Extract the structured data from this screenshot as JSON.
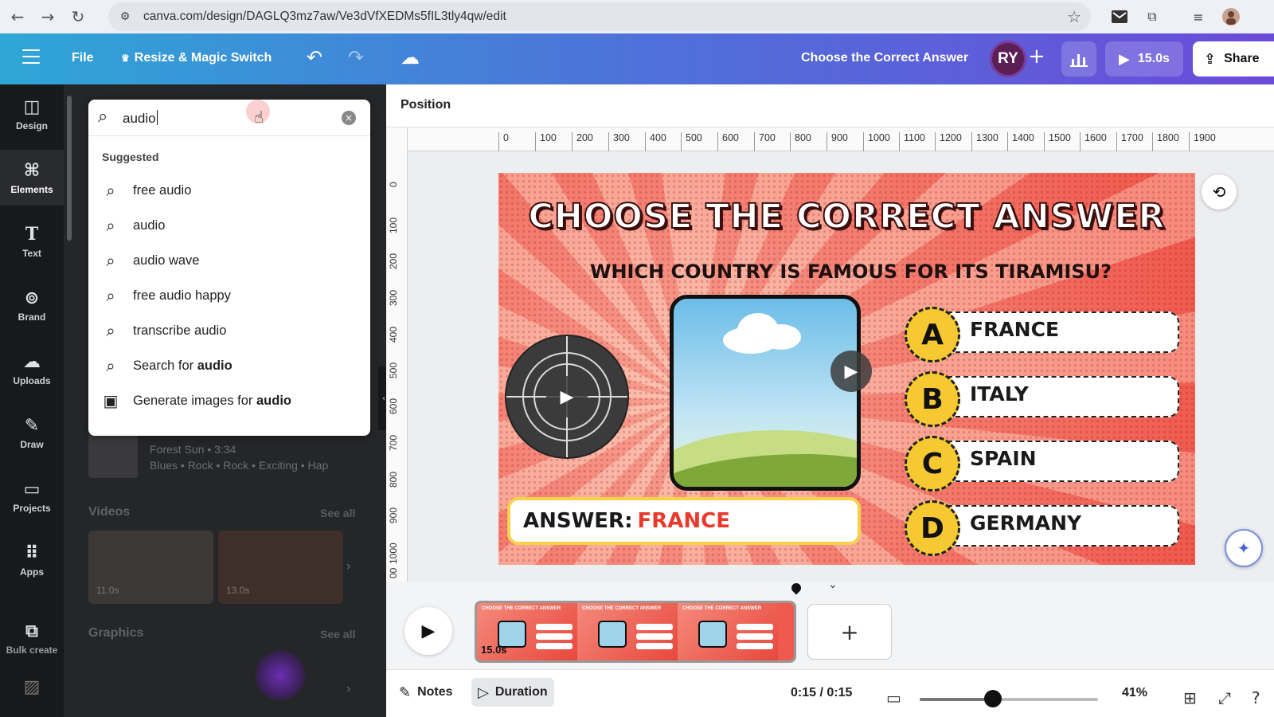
{
  "browser": {
    "url": "canva.com/design/DAGLQ3mz7aw/Ve3dVfXEDMs5fIL3tly4qw/edit"
  },
  "header": {
    "file": "File",
    "resize": "Resize & Magic Switch",
    "title": "Choose the Correct Answer",
    "avatar": "RY",
    "duration": "15.0s",
    "share": "Share"
  },
  "sidebar": {
    "items": [
      {
        "label": "Design",
        "icon": "design-icon"
      },
      {
        "label": "Elements",
        "icon": "elements-icon"
      },
      {
        "label": "Text",
        "icon": "text-icon"
      },
      {
        "label": "Brand",
        "icon": "brand-icon"
      },
      {
        "label": "Uploads",
        "icon": "uploads-icon"
      },
      {
        "label": "Draw",
        "icon": "draw-icon"
      },
      {
        "label": "Projects",
        "icon": "projects-icon"
      },
      {
        "label": "Apps",
        "icon": "apps-icon"
      },
      {
        "label": "Bulk create",
        "icon": "bulk-create-icon"
      }
    ]
  },
  "search": {
    "value": "audio",
    "suggested_title": "Suggested",
    "suggestions": [
      "free audio",
      "audio",
      "audio wave",
      "free audio happy",
      "transcribe audio"
    ],
    "search_for_prefix": "Search for ",
    "search_for_term": "audio",
    "generate_prefix": "Generate images for ",
    "generate_term": "audio"
  },
  "panel": {
    "audio_title": "Forest Sun • 3:34",
    "audio_tags": "Blues • Rock • Rock • Exciting • Hap",
    "videos_heading": "Videos",
    "see_all": "See all",
    "video_durations": [
      "11.0s",
      "13.0s"
    ],
    "graphics_heading": "Graphics"
  },
  "position_label": "Position",
  "ruler": {
    "top": [
      "0",
      "100",
      "200",
      "300",
      "400",
      "500",
      "600",
      "700",
      "800",
      "900",
      "1000",
      "1100",
      "1200",
      "1300",
      "1400",
      "1500",
      "1600",
      "1700",
      "1800",
      "1900"
    ],
    "left": [
      "0",
      "100",
      "200",
      "300",
      "400",
      "500",
      "600",
      "700",
      "800",
      "900",
      "1000",
      "00"
    ]
  },
  "design": {
    "title": "CHOOSE THE CORRECT ANSWER",
    "question": "WHICH COUNTRY IS FAMOUS FOR ITS TIRAMISU?",
    "answer_label": "ANSWER:",
    "answer_value": "FRANCE",
    "options": [
      {
        "letter": "A",
        "text": "FRANCE"
      },
      {
        "letter": "B",
        "text": "ITALY"
      },
      {
        "letter": "C",
        "text": "SPAIN"
      },
      {
        "letter": "D",
        "text": "GERMANY"
      }
    ]
  },
  "timeline": {
    "duration": "15.0s",
    "mini_title": "CHOOSE THE CORRECT ANSWER"
  },
  "bottom": {
    "notes": "Notes",
    "duration": "Duration",
    "time": "0:15 / 0:15",
    "zoom": "41%",
    "zoom_value": 0.41
  }
}
